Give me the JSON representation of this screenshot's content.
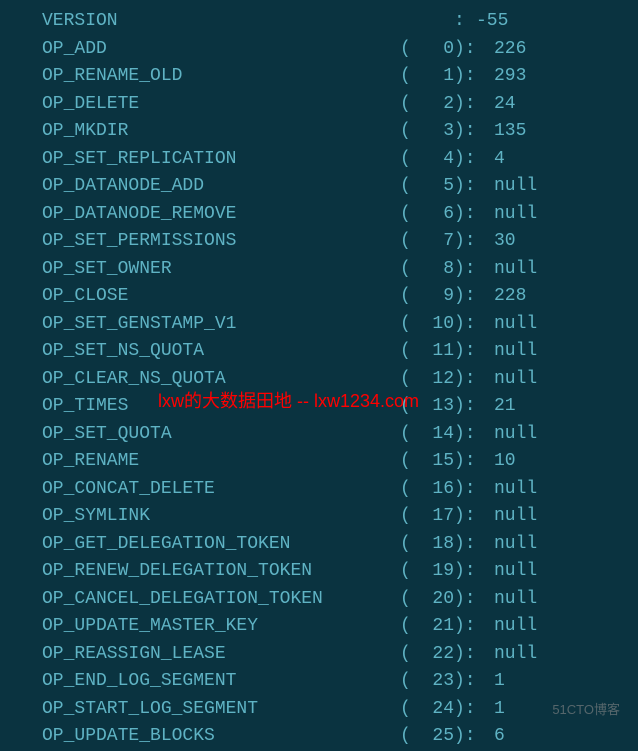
{
  "version": {
    "label": "VERSION",
    "colon": ": ",
    "value": "-55"
  },
  "ops": [
    {
      "label": "OP_ADD",
      "index": "0",
      "value": "226"
    },
    {
      "label": "OP_RENAME_OLD",
      "index": "1",
      "value": "293"
    },
    {
      "label": "OP_DELETE",
      "index": "2",
      "value": "24"
    },
    {
      "label": "OP_MKDIR",
      "index": "3",
      "value": "135"
    },
    {
      "label": "OP_SET_REPLICATION",
      "index": "4",
      "value": "4"
    },
    {
      "label": "OP_DATANODE_ADD",
      "index": "5",
      "value": "null"
    },
    {
      "label": "OP_DATANODE_REMOVE",
      "index": "6",
      "value": "null"
    },
    {
      "label": "OP_SET_PERMISSIONS",
      "index": "7",
      "value": "30"
    },
    {
      "label": "OP_SET_OWNER",
      "index": "8",
      "value": "null"
    },
    {
      "label": "OP_CLOSE",
      "index": "9",
      "value": "228"
    },
    {
      "label": "OP_SET_GENSTAMP_V1",
      "index": "10",
      "value": "null"
    },
    {
      "label": "OP_SET_NS_QUOTA",
      "index": "11",
      "value": "null"
    },
    {
      "label": "OP_CLEAR_NS_QUOTA",
      "index": "12",
      "value": "null"
    },
    {
      "label": "OP_TIMES",
      "index": "13",
      "value": "21"
    },
    {
      "label": "OP_SET_QUOTA",
      "index": "14",
      "value": "null"
    },
    {
      "label": "OP_RENAME",
      "index": "15",
      "value": "10"
    },
    {
      "label": "OP_CONCAT_DELETE",
      "index": "16",
      "value": "null"
    },
    {
      "label": "OP_SYMLINK",
      "index": "17",
      "value": "null"
    },
    {
      "label": "OP_GET_DELEGATION_TOKEN",
      "index": "18",
      "value": "null"
    },
    {
      "label": "OP_RENEW_DELEGATION_TOKEN",
      "index": "19",
      "value": "null"
    },
    {
      "label": "OP_CANCEL_DELEGATION_TOKEN",
      "index": "20",
      "value": "null"
    },
    {
      "label": "OP_UPDATE_MASTER_KEY",
      "index": "21",
      "value": "null"
    },
    {
      "label": "OP_REASSIGN_LEASE",
      "index": "22",
      "value": "null"
    },
    {
      "label": "OP_END_LOG_SEGMENT",
      "index": "23",
      "value": "1"
    },
    {
      "label": "OP_START_LOG_SEGMENT",
      "index": "24",
      "value": "1"
    },
    {
      "label": "OP_UPDATE_BLOCKS",
      "index": "25",
      "value": "6"
    }
  ],
  "watermark_red": "lxw的大数据田地 -- lxw1234.com",
  "watermark_gray": "51CTO博客"
}
